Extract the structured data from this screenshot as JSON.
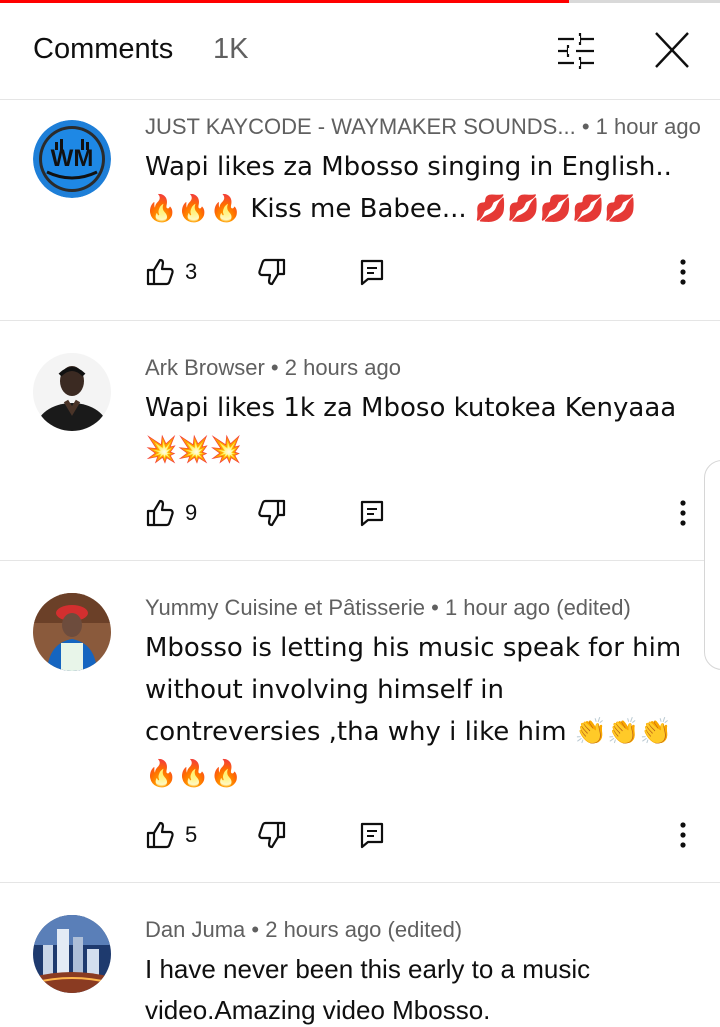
{
  "progress": {
    "played_fraction": 0.79
  },
  "header": {
    "title": "Comments",
    "count": "1K",
    "filter_icon": "tune-icon",
    "close_icon": "close-icon"
  },
  "comments": [
    {
      "author": "JUST KAYCODE - WAYMAKER SOUNDS...",
      "time": "• 1 hour ago",
      "text": "Wapi likes za Mbosso singing in English.. 🔥🔥🔥 Kiss me Babee... 💋💋💋💋💋",
      "likes": "3",
      "avatar": "wm-logo-avatar"
    },
    {
      "author": "Ark Browser",
      "time": "• 2 hours ago",
      "text": "Wapi likes 1k za Mboso kutokea Kenyaaa 💥💥💥",
      "likes": "9",
      "avatar": "man-praying-avatar"
    },
    {
      "author": "Yummy Cuisine et Pâtisserie",
      "time": "• 1 hour ago (edited)",
      "text": "Mbosso is letting his music speak for him without involving himself in contreversies ,tha why i like him  👏👏👏 🔥🔥🔥",
      "likes": "5",
      "avatar": "chef-woman-avatar"
    },
    {
      "author": "Dan Juma",
      "time": "• 2 hours ago (edited)",
      "text": "I have never been this early to a music video.Amazing video Mbosso.",
      "likes": "",
      "avatar": "city-skyline-avatar"
    }
  ],
  "colors": {
    "accent_red": "#ff0000",
    "text_primary": "#0f0f0f",
    "text_secondary": "#606060",
    "divider": "#e5e5e5"
  }
}
